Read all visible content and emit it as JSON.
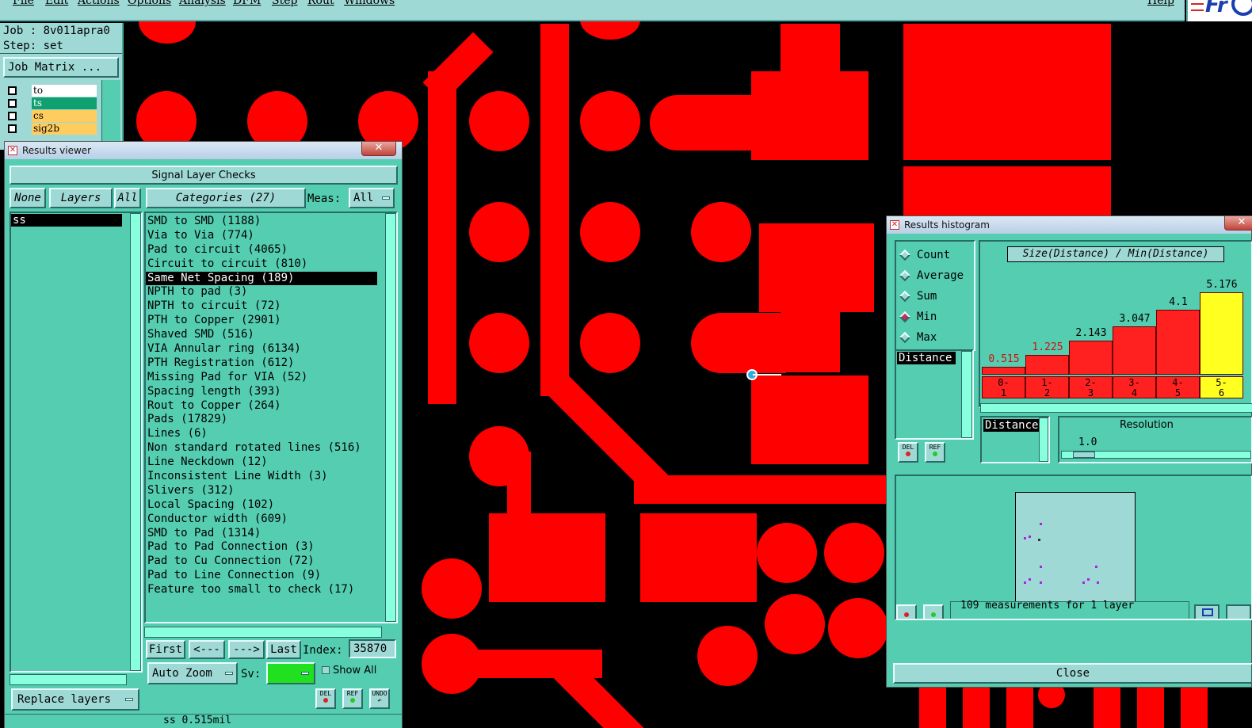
{
  "menu": [
    "File",
    "Edit",
    "Actions",
    "Options",
    "Analysis",
    "DFM",
    "Step",
    "Rout",
    "Windows"
  ],
  "menu_help": "Help",
  "logo_text": "Fr",
  "job_label": "Job : 8v011apra0",
  "step_label": "Step: set",
  "job_matrix_button": "Job Matrix ...",
  "layers_list": [
    {
      "name": "to",
      "color": "#ffffff"
    },
    {
      "name": "ts",
      "color": "#10a070"
    },
    {
      "name": "cs",
      "color": "#ffcc60"
    },
    {
      "name": "sig2b",
      "color": "#ffcc60"
    }
  ],
  "results_viewer": {
    "title": "Results viewer",
    "header": "Signal Layer Checks",
    "none_btn": "None",
    "layers_btn": "Layers",
    "all_btn": "All",
    "categories_btn": "Categories (27)",
    "meas_label": "Meas:",
    "meas_value": "All",
    "layer_items": [
      "ss"
    ],
    "categories": [
      "SMD to SMD (1188)",
      "Via to Via (774)",
      "Pad to circuit (4065)",
      "Circuit to circuit (810)",
      "Same Net Spacing (189)",
      "NPTH to pad (3)",
      "NPTH to circuit (72)",
      "PTH to Copper (2901)",
      "Shaved SMD (516)",
      "VIA Annular ring (6134)",
      "PTH Registration (612)",
      "Missing Pad for VIA (52)",
      "Spacing length (393)",
      "Rout to Copper (264)",
      "Pads (17829)",
      "Lines (6)",
      "Non standard rotated lines (516)",
      "Line Neckdown (12)",
      "Inconsistent Line Width (3)",
      "Slivers (312)",
      "Local Spacing (102)",
      "Conductor width (609)",
      "SMD to Pad (1314)",
      "Pad to Pad Connection (3)",
      "Pad to Cu Connection (72)",
      "Pad to Line Connection (9)",
      "Feature too small to check (17)"
    ],
    "selected_category": 4,
    "first_btn": "First",
    "prev_btn": "<---",
    "next_btn": "--->",
    "last_btn": "Last",
    "index_label": "Index:",
    "index_value": "35870",
    "auto_zoom": "Auto Zoom",
    "sv_label": "Sv:",
    "show_all": "Show All",
    "replace_layers": "Replace layers",
    "del_btn": "DEL",
    "ref_btn": "REF",
    "undo_btn": "UNDO",
    "status_text": "ss 0.515mil"
  },
  "histogram": {
    "title": "Results histogram",
    "radios": [
      "Count",
      "Average",
      "Sum",
      "Min",
      "Max"
    ],
    "selected_radio": "Min",
    "attr_item": "Distance",
    "chart_title": "Size(Distance) / Min(Distance)",
    "resolution_label": "Resolution",
    "resolution_value": "1.0",
    "res_attr": "Distance",
    "footer_text": "109 measurements for 1 layer",
    "close_btn": "Close",
    "del_btn": "DEL",
    "ref_btn": "REF"
  },
  "chart_data": {
    "type": "bar",
    "title": "Size(Distance) / Min(Distance)",
    "categories": [
      "0-1",
      "1-2",
      "2-3",
      "3-4",
      "4-5",
      "5-6"
    ],
    "values": [
      0.515,
      1.225,
      2.143,
      3.047,
      4.1,
      5.176
    ],
    "value_labels": [
      "0.515",
      "1.225",
      "2.143",
      "3.047",
      "4.1",
      "5.176"
    ],
    "highlight_index": 5,
    "ylim": [
      0,
      5.176
    ],
    "colors": {
      "bar": "#ff2020",
      "highlight": "#ffff20",
      "label_red": "#d01010"
    }
  }
}
